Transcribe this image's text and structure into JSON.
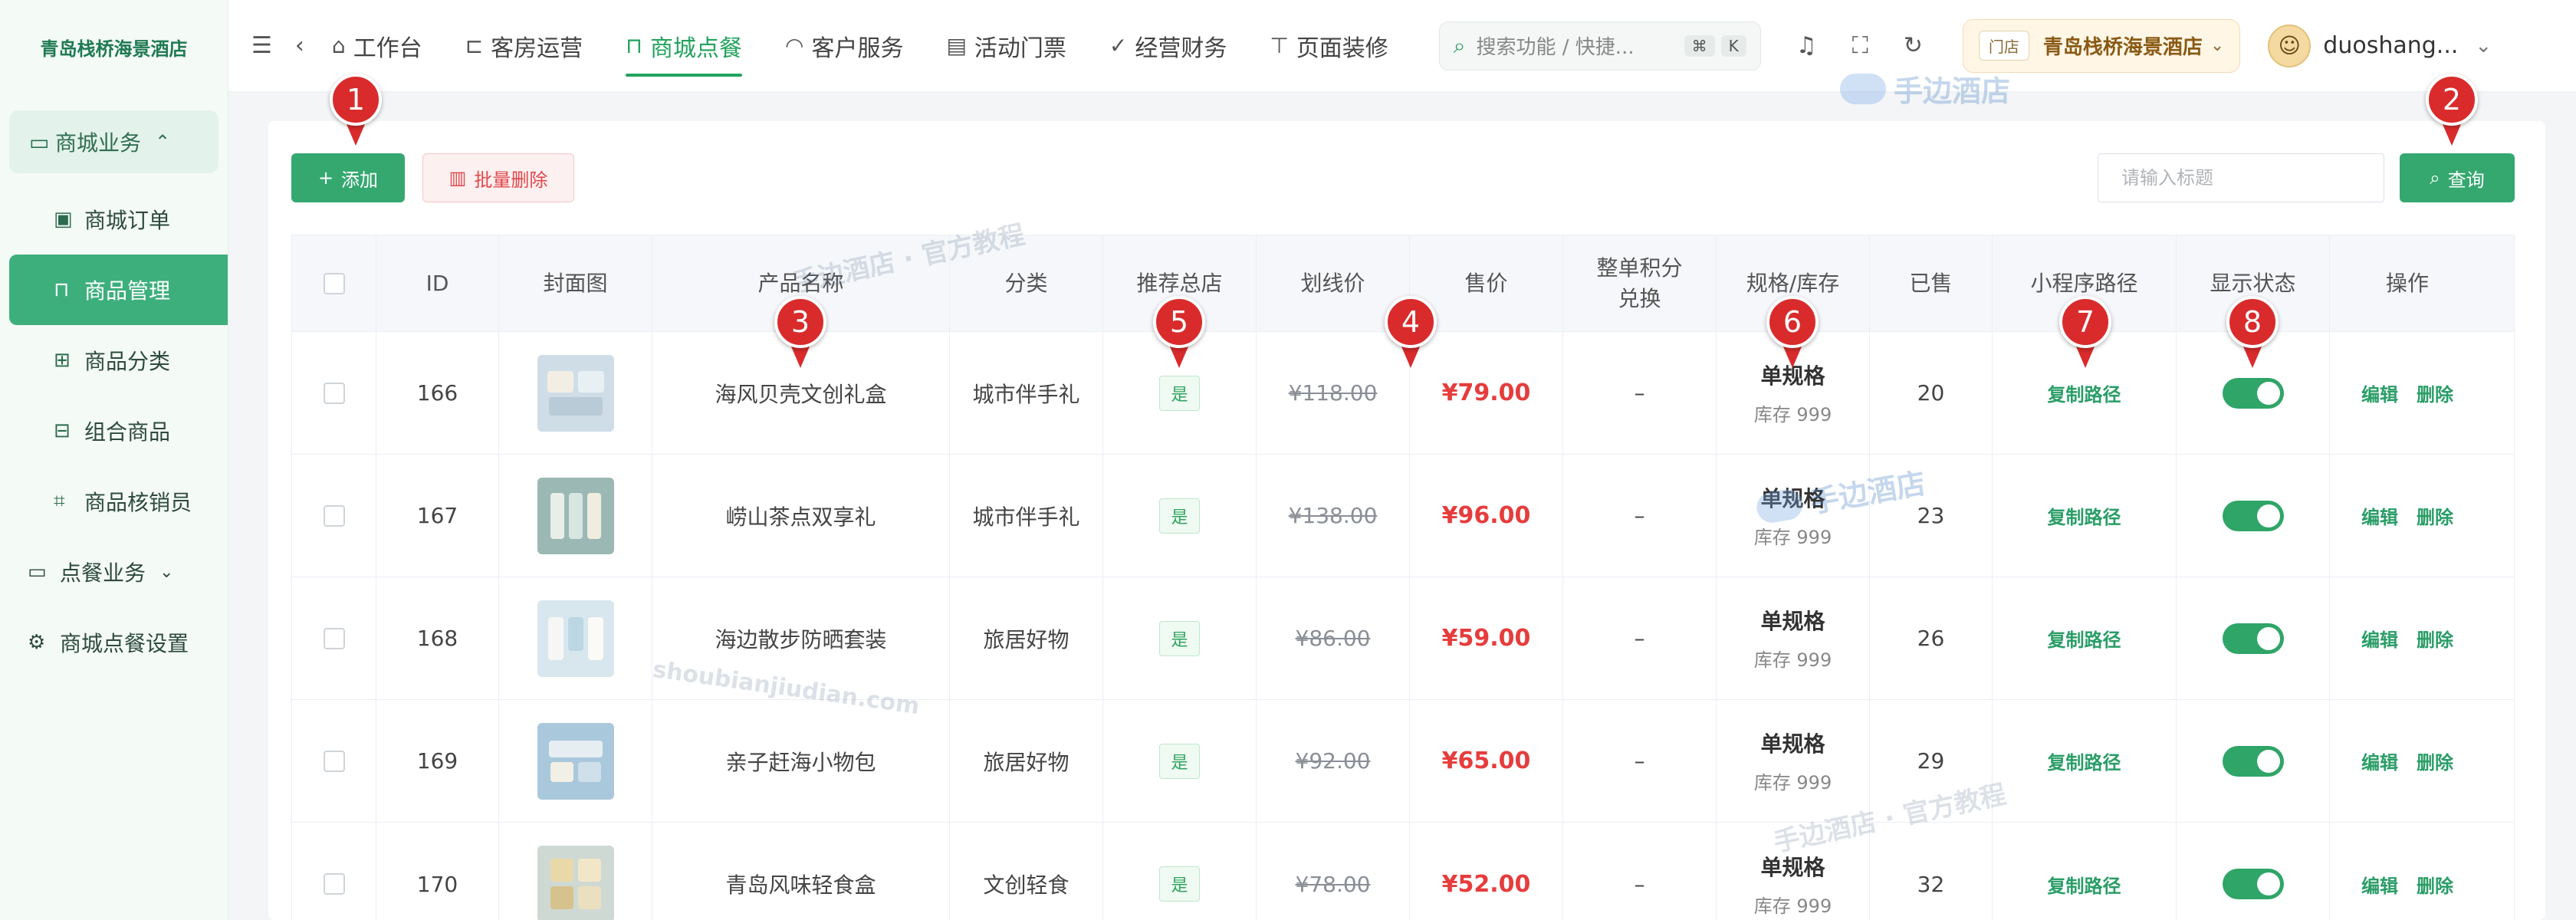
{
  "sidebar": {
    "brand": "青岛栈桥海景酒店",
    "group_mall": "商城业务",
    "items": [
      {
        "label": "商城订单",
        "icon": "bag-icon"
      },
      {
        "label": "商品管理",
        "icon": "lock-icon"
      },
      {
        "label": "商品分类",
        "icon": "grid-icon"
      },
      {
        "label": "组合商品",
        "icon": "basket-icon"
      },
      {
        "label": "商品核销员",
        "icon": "scan-icon"
      }
    ],
    "group_order": "点餐业务",
    "settings": "商城点餐设置"
  },
  "topbar": {
    "nav": [
      {
        "label": "工作台",
        "icon": "home-icon"
      },
      {
        "label": "客房运营",
        "icon": "bed-icon"
      },
      {
        "label": "商城点餐",
        "icon": "bag-icon"
      },
      {
        "label": "客户服务",
        "icon": "headset-icon"
      },
      {
        "label": "活动门票",
        "icon": "ticket-icon"
      },
      {
        "label": "经营财务",
        "icon": "check-circle-icon"
      },
      {
        "label": "页面装修",
        "icon": "brush-icon"
      }
    ],
    "search_placeholder": "搜索功能 / 快捷...",
    "kbd1": "⌘",
    "kbd2": "K",
    "store_tag": "门店",
    "store_name": "青岛栈桥海景酒店",
    "username": "duoshang..."
  },
  "toolbar": {
    "add_label": "添加",
    "batch_delete_label": "批量删除",
    "title_placeholder": "请输入标题",
    "query_label": "查询"
  },
  "table": {
    "headers": {
      "id": "ID",
      "cover": "封面图",
      "name": "产品名称",
      "category": "分类",
      "recommend": "推荐总店",
      "original_price": "划线价",
      "price": "售价",
      "points": "整单积分兑换",
      "spec": "规格/库存",
      "sold": "已售",
      "path": "小程序路径",
      "status": "显示状态",
      "ops": "操作"
    },
    "rows": [
      {
        "id": "166",
        "name": "海风贝壳文创礼盒",
        "category": "城市伴手礼",
        "recommend": "是",
        "original_price": "¥118.00",
        "price": "¥79.00",
        "points": "–",
        "spec": "单规格",
        "stock": "库存 999",
        "sold": "20",
        "path": "复制路径",
        "edit": "编辑",
        "delete": "删除"
      },
      {
        "id": "167",
        "name": "崂山茶点双享礼",
        "category": "城市伴手礼",
        "recommend": "是",
        "original_price": "¥138.00",
        "price": "¥96.00",
        "points": "–",
        "spec": "单规格",
        "stock": "库存 999",
        "sold": "23",
        "path": "复制路径",
        "edit": "编辑",
        "delete": "删除"
      },
      {
        "id": "168",
        "name": "海边散步防晒套装",
        "category": "旅居好物",
        "recommend": "是",
        "original_price": "¥86.00",
        "price": "¥59.00",
        "points": "–",
        "spec": "单规格",
        "stock": "库存 999",
        "sold": "26",
        "path": "复制路径",
        "edit": "编辑",
        "delete": "删除"
      },
      {
        "id": "169",
        "name": "亲子赶海小物包",
        "category": "旅居好物",
        "recommend": "是",
        "original_price": "¥92.00",
        "price": "¥65.00",
        "points": "–",
        "spec": "单规格",
        "stock": "库存 999",
        "sold": "29",
        "path": "复制路径",
        "edit": "编辑",
        "delete": "删除"
      },
      {
        "id": "170",
        "name": "青岛风味轻食盒",
        "category": "文创轻食",
        "recommend": "是",
        "original_price": "¥78.00",
        "price": "¥52.00",
        "points": "–",
        "spec": "单规格",
        "stock": "库存 999",
        "sold": "32",
        "path": "复制路径",
        "edit": "编辑",
        "delete": "删除"
      }
    ]
  },
  "markers": [
    "1",
    "2",
    "3",
    "4",
    "5",
    "6",
    "7",
    "8"
  ],
  "watermarks": {
    "logo": "手边酒店",
    "text1": "手边酒店 · 官方教程",
    "text2": "shoubianjiudian.com"
  },
  "colors": {
    "accent": "#35a86f",
    "danger": "#e63c3c",
    "marker": "#d92b2b"
  }
}
